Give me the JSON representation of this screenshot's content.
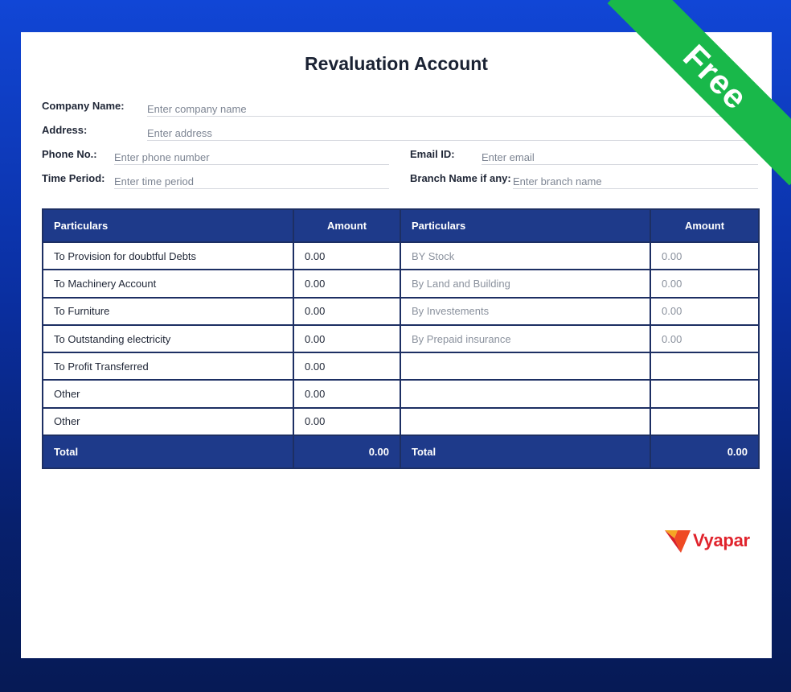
{
  "badge": "Free",
  "title": "Revaluation Account",
  "fields": {
    "company_label": "Company Name:",
    "company_ph": "Enter company name",
    "address_label": "Address:",
    "address_ph": "Enter address",
    "phone_label": "Phone No.:",
    "phone_ph": "Enter phone number",
    "email_label": "Email ID:",
    "email_ph": "Enter email",
    "period_label": "Time Period:",
    "period_ph": "Enter time period",
    "branch_label": "Branch Name if any:",
    "branch_ph": "Enter branch name"
  },
  "table": {
    "headers": [
      "Particulars",
      "Amount",
      "Particulars",
      "Amount"
    ],
    "rows": [
      [
        "To Provision for doubtful Debts",
        "0.00",
        "BY Stock",
        "0.00"
      ],
      [
        "To Machinery Account",
        "0.00",
        "By Land and Building",
        "0.00"
      ],
      [
        "To Furniture",
        "0.00",
        "By Investements",
        "0.00"
      ],
      [
        "To Outstanding electricity",
        "0.00",
        "By Prepaid insurance",
        "0.00"
      ],
      [
        "To Profit Transferred",
        "0.00",
        "",
        ""
      ],
      [
        "Other",
        "0.00",
        "",
        ""
      ],
      [
        "Other",
        "0.00",
        "",
        ""
      ]
    ],
    "total_label_left": "Total",
    "total_left": "0.00",
    "total_label_right": "Total",
    "total_right": "0.00"
  },
  "brand": {
    "name": "Vyapar",
    "color": "#e0232c"
  },
  "colors": {
    "header": "#1e3a8a",
    "badge": "#19b84a"
  }
}
